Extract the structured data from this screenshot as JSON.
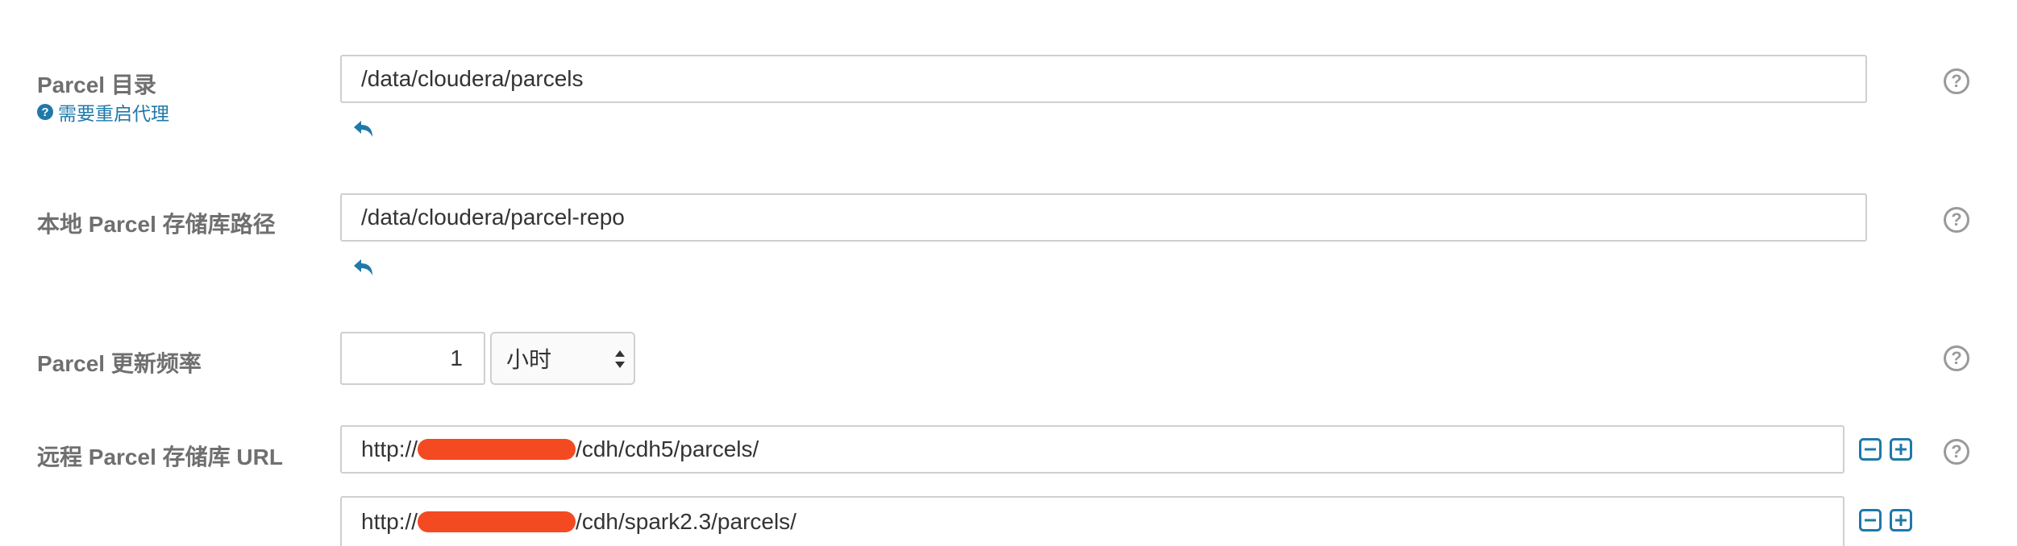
{
  "parcel_dir": {
    "label": "Parcel 目录",
    "restart_note": "需要重启代理",
    "value": "/data/cloudera/parcels"
  },
  "local_repo": {
    "label": "本地 Parcel 存储库路径",
    "value": "/data/cloudera/parcel-repo"
  },
  "update_freq": {
    "label": "Parcel 更新频率",
    "value": "1",
    "unit": "小时"
  },
  "remote_repo": {
    "label": "远程 Parcel 存储库 URL",
    "urls": [
      {
        "prefix": "http://",
        "suffix": "/cdh/cdh5/parcels/"
      },
      {
        "prefix": "http://",
        "suffix": "/cdh/spark2.3/parcels/"
      }
    ]
  },
  "help_glyph": "?",
  "icons": {
    "undo": "undo-arrow-icon",
    "help": "question-circle-icon",
    "remove": "minus-square-icon",
    "add": "plus-square-icon"
  },
  "colors": {
    "link": "#1f79a9",
    "redaction": "#f34a22",
    "label": "#6f6f6f"
  }
}
